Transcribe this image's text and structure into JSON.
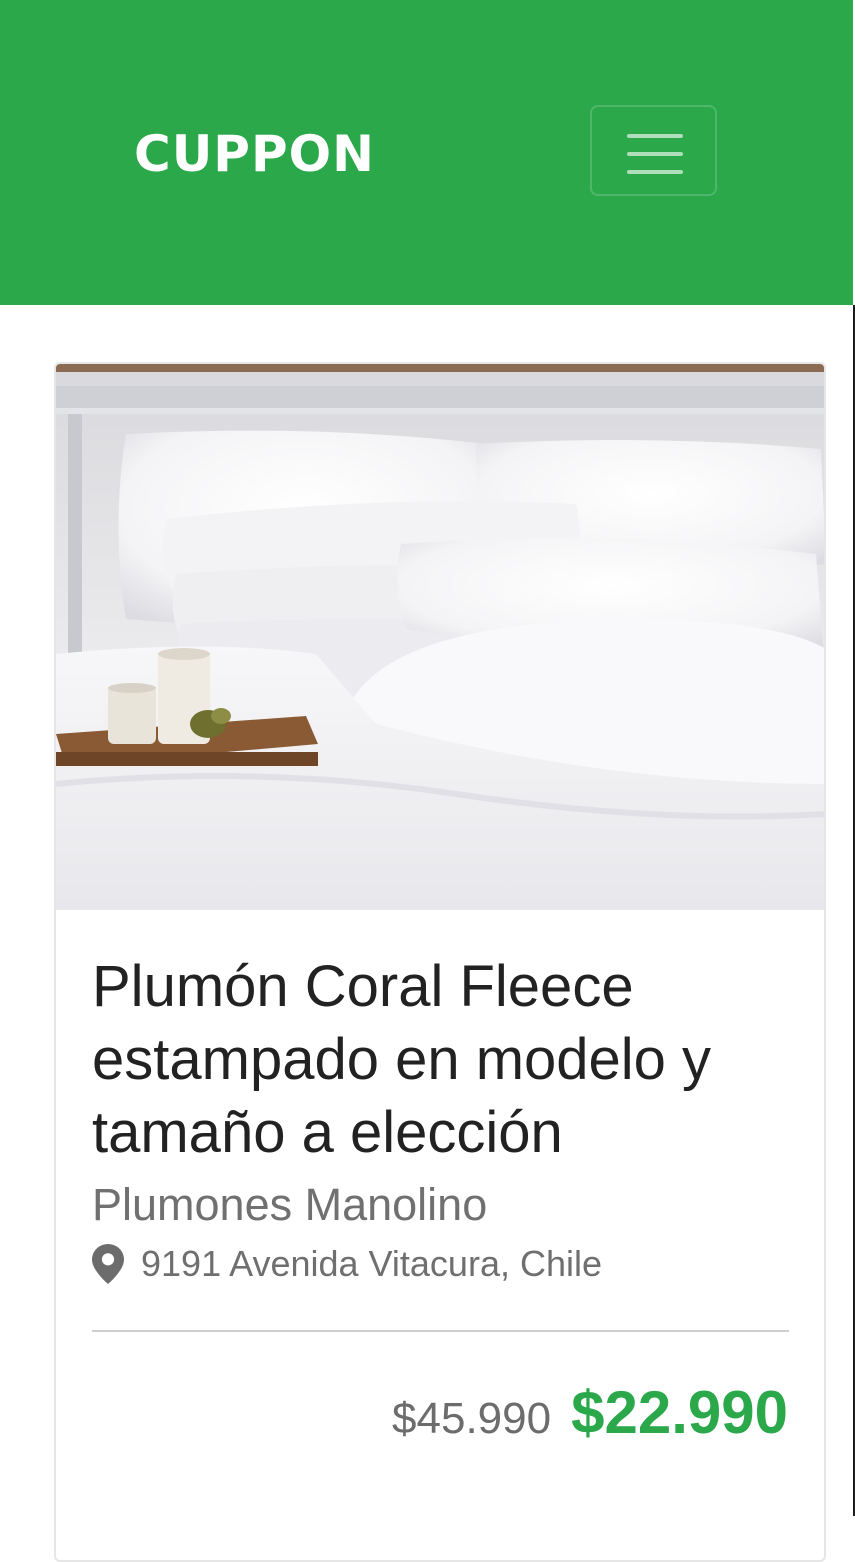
{
  "header": {
    "brand": "CUPPON",
    "menu_icon": "hamburger-menu-icon",
    "background_color": "#2aa84a"
  },
  "deal": {
    "image_alt": "white pillows and duvet on a bed with candles on a wooden tray",
    "title": "Plumón Coral Fleece estampado en modelo y tamaño a elección",
    "merchant": "Plumones Manolino",
    "location_icon": "map-pin-icon",
    "address": "9191 Avenida Vitacura, Chile",
    "original_price": "$45.990",
    "deal_price": "$22.990",
    "price_color": "#2aa84a"
  }
}
